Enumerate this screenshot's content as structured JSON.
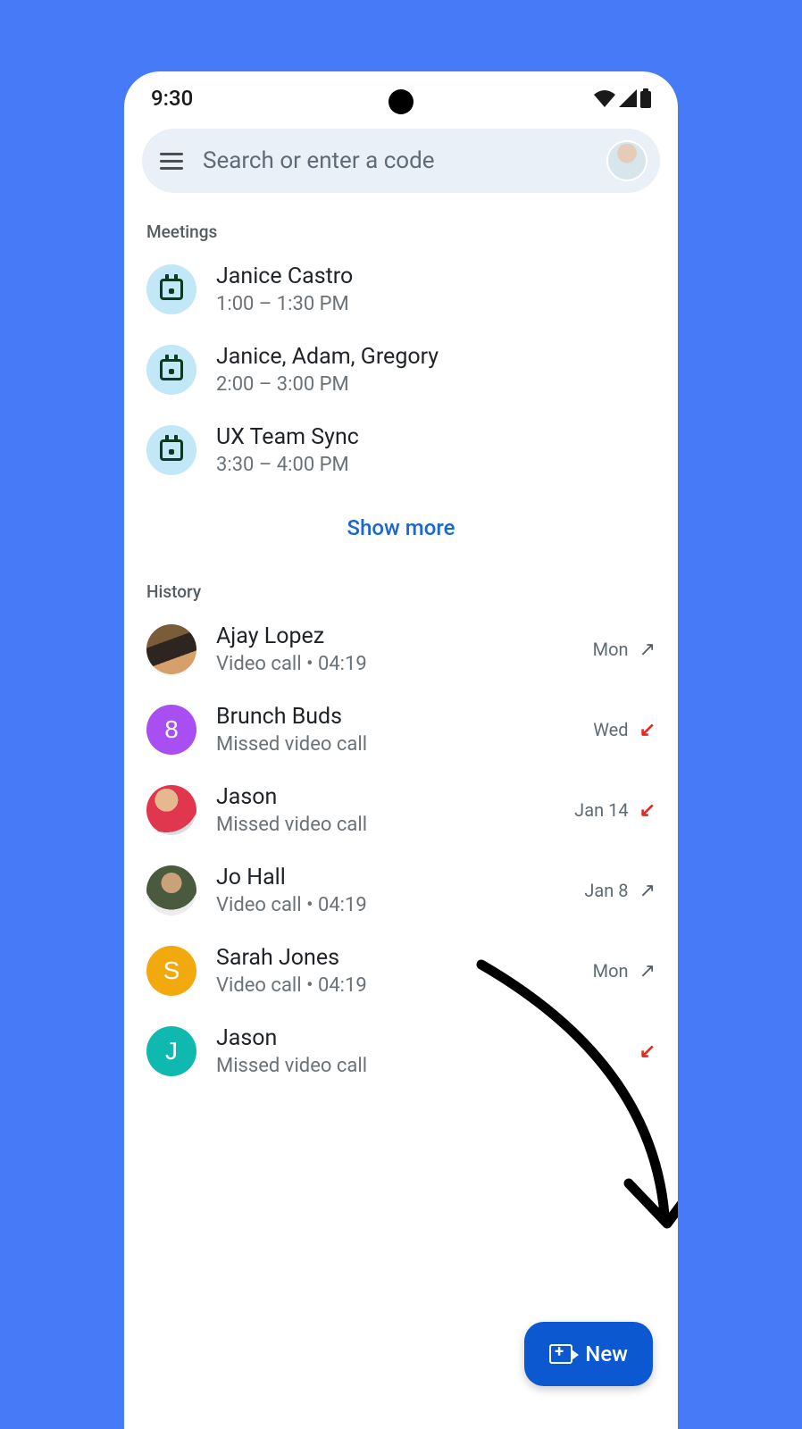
{
  "statusbar": {
    "time": "9:30"
  },
  "search": {
    "placeholder": "Search or enter a code"
  },
  "sections": {
    "meetings_label": "Meetings",
    "history_label": "History"
  },
  "meetings": [
    {
      "title": "Janice Castro",
      "sub": "1:00 – 1:30 PM"
    },
    {
      "title": "Janice, Adam, Gregory",
      "sub": "2:00 – 3:00 PM"
    },
    {
      "title": "UX Team Sync",
      "sub": "3:30 – 4:00 PM"
    }
  ],
  "show_more": "Show more",
  "history": [
    {
      "name": "Ajay Lopez",
      "sub": "Video call  •  04:19",
      "date": "Mon",
      "type": "out",
      "avatar": {
        "kind": "photo",
        "bg": "linear-gradient(160deg,#7a5b3a 0 35%,#2e2520 35% 65%,#d7a06a 65% 100%)"
      }
    },
    {
      "name": "Brunch Buds",
      "sub": "Missed video call",
      "date": "Wed",
      "type": "missed",
      "avatar": {
        "kind": "letter",
        "letter": "8",
        "bg": "#a94ef0"
      }
    },
    {
      "name": "Jason",
      "sub": "Missed video call",
      "date": "Jan 14",
      "type": "missed",
      "avatar": {
        "kind": "photo",
        "bg": "radial-gradient(circle at 40% 30%, #e7b890 0 25%, #e0364e 25% 70%, #d9dee2 70% 100%)"
      }
    },
    {
      "name": "Jo Hall",
      "sub": "Video call  •  04:19",
      "date": "Jan 8",
      "type": "out",
      "avatar": {
        "kind": "photo",
        "bg": "radial-gradient(circle at 50% 35%, #caa27a 0 25%, #4a5a3e 25% 65%, #ececec 65% 100%)"
      }
    },
    {
      "name": "Sarah Jones",
      "sub": "Video call  •  04:19",
      "date": "Mon",
      "type": "out",
      "avatar": {
        "kind": "letter",
        "letter": "S",
        "bg": "#f2a90d"
      }
    },
    {
      "name": "Jason",
      "sub": "Missed video call",
      "date": "",
      "type": "missed",
      "avatar": {
        "kind": "letter",
        "letter": "J",
        "bg": "#10b9b0"
      }
    }
  ],
  "fab": {
    "label": "New"
  }
}
